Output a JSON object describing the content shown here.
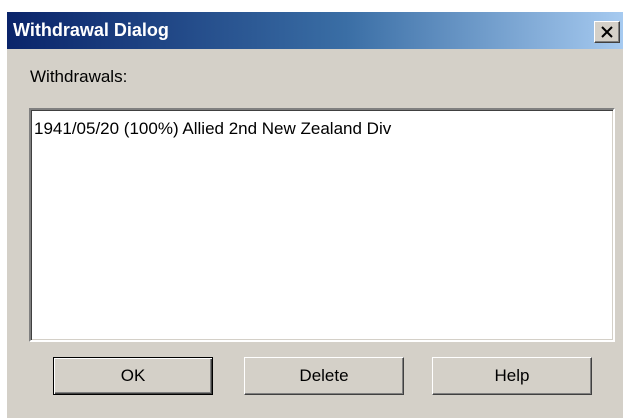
{
  "window": {
    "title": "Withdrawal Dialog",
    "close_icon": "close-x-icon"
  },
  "withdrawals": {
    "label": "Withdrawals:",
    "items": [
      "1941/05/20 (100%) Allied 2nd New Zealand Div"
    ]
  },
  "buttons": {
    "ok_label": "OK",
    "delete_label": "Delete",
    "help_label": "Help"
  },
  "colors": {
    "dialog_background": "#d4d0c8",
    "titlebar_start": "#0a246a",
    "titlebar_end": "#a6caf0",
    "title_text": "#ffffff"
  }
}
